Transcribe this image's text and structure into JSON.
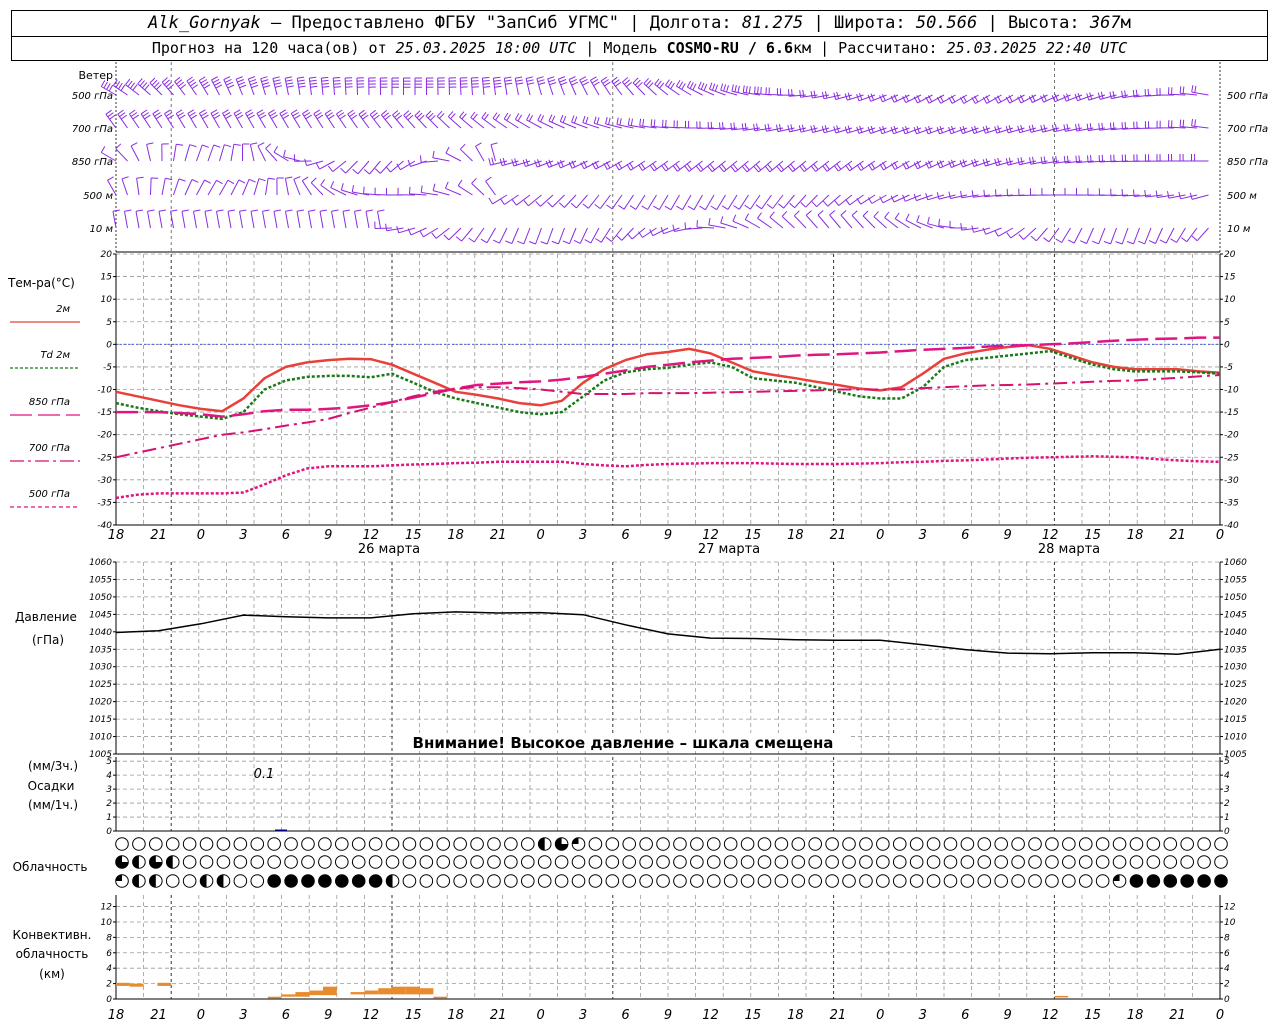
{
  "header": {
    "station": "Alk_Gornyak",
    "provided": " – Предоставлено ФГБУ \"ЗапСиб УГМС\" | Долгота: ",
    "lon": "81.275",
    "lat_label": " | Широта: ",
    "lat": "50.566",
    "alt_label": " | Высота: ",
    "alt": "367",
    "alt_unit": "м",
    "forecast_label": "Прогноз на 120 часа(ов) от ",
    "forecast_from": "25.03.2025 18:00 UTC",
    "model_label": " | Модель ",
    "model": "COSMO-RU / 6.6",
    "model_unit": "км",
    "calc_label": " | Рассчитано: ",
    "calc_time": "25.03.2025 22:40 UTC"
  },
  "colors": {
    "wind": "#8a2be2",
    "t2m": "#e8403a",
    "td2m": "#1a7a1a",
    "t850": "#e0157f",
    "t700": "#d81070",
    "t500": "#e0157f",
    "pressure": "#000000",
    "precip": "#000080",
    "conv": "#e88a2e",
    "grid": "#9a9a9a"
  },
  "wind_panel": {
    "title": "Ветер",
    "levels": [
      "500 гПа",
      "700 гПа",
      "850 гПа",
      "500 м",
      "10 м"
    ]
  },
  "temp_panel": {
    "title": "Тем-ра(°С)",
    "legend": [
      "2м",
      "Td 2м",
      "850 гПа",
      "700 гПа",
      "500 гПа"
    ],
    "ticks": [
      "20",
      "15",
      "10",
      "5",
      "0",
      "-5",
      "-10",
      "-15",
      "-20",
      "-25",
      "-30",
      "-35",
      "-40"
    ]
  },
  "time_axis": {
    "hours": [
      "18",
      "21",
      "0",
      "3",
      "6",
      "9",
      "12",
      "15",
      "18",
      "21",
      "0",
      "3",
      "6",
      "9",
      "12",
      "15",
      "18",
      "21",
      "0",
      "3",
      "6",
      "9",
      "12",
      "15",
      "18",
      "21",
      "0"
    ],
    "days": [
      "26 марта",
      "27 марта",
      "28 марта"
    ]
  },
  "pressure_panel": {
    "title": "Давление",
    "unit": "(гПа)",
    "ticks": [
      "1060",
      "1055",
      "1050",
      "1045",
      "1040",
      "1035",
      "1030",
      "1025",
      "1020",
      "1015",
      "1010",
      "1005"
    ],
    "warning": "Внимание! Высокое давление – шкала смещена"
  },
  "precip_panel": {
    "unit3": "(мм/3ч.)",
    "title": "Осадки",
    "unit1": "(мм/1ч.)",
    "ticks": [
      "5",
      "4",
      "3",
      "2",
      "1",
      "0"
    ],
    "note": "0.1"
  },
  "cloud_panel": {
    "title": "Облачность"
  },
  "conv_panel": {
    "title1": "Конвективн.",
    "title2": "облачность",
    "unit": "(км)",
    "ticks": [
      "12",
      "10",
      "8",
      "6",
      "4",
      "2",
      "0"
    ]
  },
  "chart_data": [
    {
      "type": "line",
      "title": "Тем-ра(°С)",
      "ylim": [
        -40,
        20
      ],
      "x_hours": [
        18,
        19.5,
        21,
        22.5,
        0,
        1.5,
        3,
        4.5,
        6,
        7.5,
        9,
        10.5,
        12,
        13.5,
        15,
        16.5,
        18,
        19.5,
        21,
        22.5,
        0,
        1.5,
        3,
        4.5,
        6,
        7.5,
        9,
        10.5,
        12,
        13.5,
        15,
        16.5,
        18,
        19.5,
        21,
        22.5,
        0,
        1.5,
        3,
        4.5,
        6,
        7.5,
        9,
        10.5,
        12,
        13.5,
        15,
        16.5,
        18,
        19.5,
        21,
        22.5,
        0
      ],
      "series": [
        {
          "name": "2м",
          "values": [
            -10.5,
            -11.5,
            -12.5,
            -13.5,
            -14.3,
            -14.8,
            -12,
            -7.5,
            -5,
            -4,
            -3.5,
            -3.2,
            -3.3,
            -4.5,
            -6.5,
            -8.5,
            -10.5,
            -11.2,
            -12,
            -13,
            -13.5,
            -12.5,
            -8.5,
            -5.5,
            -3.5,
            -2.2,
            -1.7,
            -1,
            -2,
            -4,
            -6,
            -6.8,
            -7.5,
            -8.3,
            -9,
            -9.8,
            -10.2,
            -9.5,
            -6.5,
            -3.2,
            -2,
            -1.2,
            -0.6,
            -0.2,
            -1,
            -2.5,
            -4,
            -5,
            -5.5,
            -5.5,
            -5.5,
            -6,
            -6.3
          ]
        },
        {
          "name": "Td 2м",
          "values": [
            -13,
            -14,
            -14.8,
            -15.5,
            -16,
            -16.5,
            -15,
            -10,
            -8,
            -7.2,
            -7,
            -7,
            -7.3,
            -6.5,
            -8.5,
            -10.5,
            -12,
            -13,
            -14,
            -15,
            -15.5,
            -15,
            -11.5,
            -8,
            -6.2,
            -5.5,
            -5.2,
            -4.5,
            -4,
            -5,
            -7.5,
            -8,
            -8.5,
            -9.5,
            -10.5,
            -11.5,
            -12,
            -12,
            -9.5,
            -5,
            -3.5,
            -3,
            -2.5,
            -2,
            -1.5,
            -3,
            -4.5,
            -5.5,
            -6,
            -6,
            -6,
            -6.2,
            -6.5
          ]
        },
        {
          "name": "850 гПа",
          "values": [
            -15,
            -15,
            -15,
            -15.2,
            -15.5,
            -16,
            -15.5,
            -14.8,
            -14.5,
            -14.5,
            -14.3,
            -14,
            -13.5,
            -12.8,
            -11.8,
            -10.8,
            -9.8,
            -9,
            -8.7,
            -8.4,
            -8.2,
            -7.8,
            -7.2,
            -6.5,
            -5.8,
            -5,
            -4.5,
            -4,
            -3.6,
            -3.2,
            -3,
            -2.8,
            -2.5,
            -2.3,
            -2.2,
            -2,
            -1.8,
            -1.5,
            -1.2,
            -1,
            -0.8,
            -0.5,
            -0.3,
            -0.2,
            0,
            0.2,
            0.5,
            0.8,
            1,
            1.2,
            1.3,
            1.5,
            1.5
          ]
        },
        {
          "name": "700 гПа",
          "values": [
            -25,
            -24,
            -23,
            -22,
            -21,
            -20,
            -19.5,
            -18.8,
            -18,
            -17.3,
            -16.5,
            -15.2,
            -14,
            -12.8,
            -11.5,
            -10.5,
            -9.8,
            -9.5,
            -9.5,
            -9.7,
            -10,
            -10.5,
            -11,
            -11,
            -11,
            -10.8,
            -10.8,
            -10.8,
            -10.7,
            -10.6,
            -10.5,
            -10.4,
            -10.3,
            -10.2,
            -10,
            -10,
            -10,
            -10,
            -9.7,
            -9.5,
            -9.3,
            -9.1,
            -9,
            -8.9,
            -8.7,
            -8.5,
            -8.3,
            -8.1,
            -8,
            -7.7,
            -7.4,
            -7.1,
            -6.8
          ]
        },
        {
          "name": "500 гПа",
          "values": [
            -34,
            -33.3,
            -33,
            -33,
            -33,
            -33,
            -32.8,
            -31,
            -29,
            -27.5,
            -27,
            -27,
            -27,
            -26.8,
            -26.6,
            -26.5,
            -26.3,
            -26.2,
            -26,
            -26,
            -26,
            -26,
            -26.5,
            -26.8,
            -27,
            -26.7,
            -26.5,
            -26.4,
            -26.3,
            -26.3,
            -26.3,
            -26.4,
            -26.5,
            -26.5,
            -26.5,
            -26.4,
            -26.3,
            -26.1,
            -26,
            -25.8,
            -25.7,
            -25.5,
            -25.3,
            -25.1,
            -25,
            -24.9,
            -24.8,
            -24.9,
            -25,
            -25.4,
            -25.7,
            -25.9,
            -26
          ]
        }
      ]
    },
    {
      "type": "line",
      "title": "Давление",
      "ylim": [
        1005,
        1060
      ],
      "x_hours": [
        18,
        21,
        0,
        3,
        6,
        9,
        12,
        15,
        18,
        21,
        0,
        3,
        6,
        9,
        12,
        15,
        18,
        21,
        0,
        3,
        6,
        9,
        12,
        15,
        18,
        21,
        0
      ],
      "series": [
        {
          "name": "Давление",
          "values": [
            1039.8,
            1040.3,
            1042.3,
            1044.8,
            1044.3,
            1044,
            1044,
            1045.2,
            1045.7,
            1045.4,
            1045.5,
            1044.9,
            1042,
            1039.4,
            1038.2,
            1038.1,
            1037.7,
            1037.6,
            1037.6,
            1036.3,
            1034.9,
            1033.9,
            1033.7,
            1034,
            1034,
            1033.6,
            1035
          ]
        }
      ]
    },
    {
      "type": "bar",
      "title": "Конвективн. облачность (км)",
      "ylim": [
        0,
        12
      ],
      "bars": [
        {
          "x0": 0,
          "x1": 1,
          "base": 1.7,
          "top": 2.1
        },
        {
          "x0": 1,
          "x1": 2,
          "base": 1.6,
          "top": 2.0
        },
        {
          "x0": 3,
          "x1": 4,
          "base": 1.7,
          "top": 2.1
        },
        {
          "x0": 11,
          "x1": 12,
          "base": 0.1,
          "top": 0.3
        },
        {
          "x0": 12,
          "x1": 13,
          "base": 0.3,
          "top": 0.6
        },
        {
          "x0": 13,
          "x1": 14,
          "base": 0.3,
          "top": 0.9
        },
        {
          "x0": 14,
          "x1": 15,
          "base": 0.5,
          "top": 1.1
        },
        {
          "x0": 15,
          "x1": 16,
          "base": 0.5,
          "top": 1.6
        },
        {
          "x0": 17,
          "x1": 18,
          "base": 0.6,
          "top": 0.9
        },
        {
          "x0": 18,
          "x1": 19,
          "base": 0.6,
          "top": 1.1
        },
        {
          "x0": 19,
          "x1": 20,
          "base": 0.6,
          "top": 1.4
        },
        {
          "x0": 20,
          "x1": 21,
          "base": 0.6,
          "top": 1.6
        },
        {
          "x0": 21,
          "x1": 22,
          "base": 0.6,
          "top": 1.6
        },
        {
          "x0": 22,
          "x1": 23,
          "base": 0.6,
          "top": 1.4
        },
        {
          "x0": 23,
          "x1": 24,
          "base": 0.1,
          "top": 0.3
        },
        {
          "x0": 68,
          "x1": 69,
          "base": 0.2,
          "top": 0.4
        }
      ]
    },
    {
      "type": "bar",
      "title": "Осадки (мм/1ч.)",
      "ylim": [
        0,
        5
      ],
      "bars": [
        {
          "x0": 13,
          "x1": 14,
          "top": 0.1
        }
      ]
    }
  ]
}
